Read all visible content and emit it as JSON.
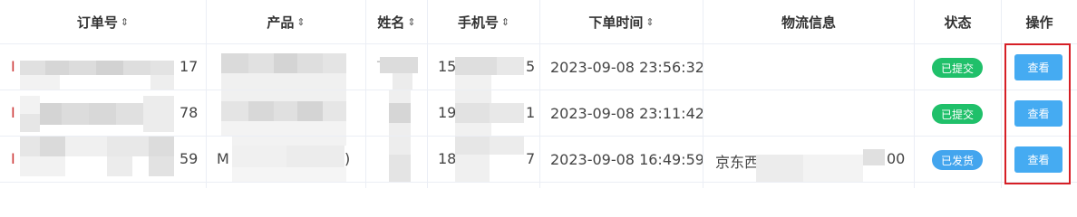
{
  "table": {
    "headers": [
      "订单号",
      "产品",
      "姓名",
      "手机号",
      "下单时间",
      "物流信息",
      "状态",
      "操作"
    ],
    "sort_icon": "⇕",
    "rows": [
      {
        "order_prefix": "I",
        "order_suffix": "17",
        "name_prefix": "T",
        "phone_prefix": "15",
        "phone_suffix": "5",
        "time": "2023-09-08 23:56:32",
        "logistics": "",
        "logistics_suffix": "",
        "status": "已提交",
        "action": "查看"
      },
      {
        "order_prefix": "I",
        "order_suffix": "78",
        "name_prefix": "",
        "phone_prefix": "19",
        "phone_suffix": "1",
        "time": "2023-09-08 23:11:42",
        "logistics": "",
        "logistics_suffix": "",
        "status": "已提交",
        "action": "查看"
      },
      {
        "order_prefix": "I",
        "order_suffix": "59",
        "product_prefix": "M",
        "product_suffix": ")",
        "phone_prefix": "18",
        "phone_suffix": "7",
        "time": "2023-09-08 16:49:59",
        "logistics": "京东西",
        "logistics_suffix": "00",
        "status": "已发货",
        "action": "查看"
      }
    ]
  },
  "colors": {
    "status_submitted": "#20c06a",
    "status_shipped": "#43a5ee",
    "action_button": "#45abf2",
    "highlight": "#d61f26"
  }
}
